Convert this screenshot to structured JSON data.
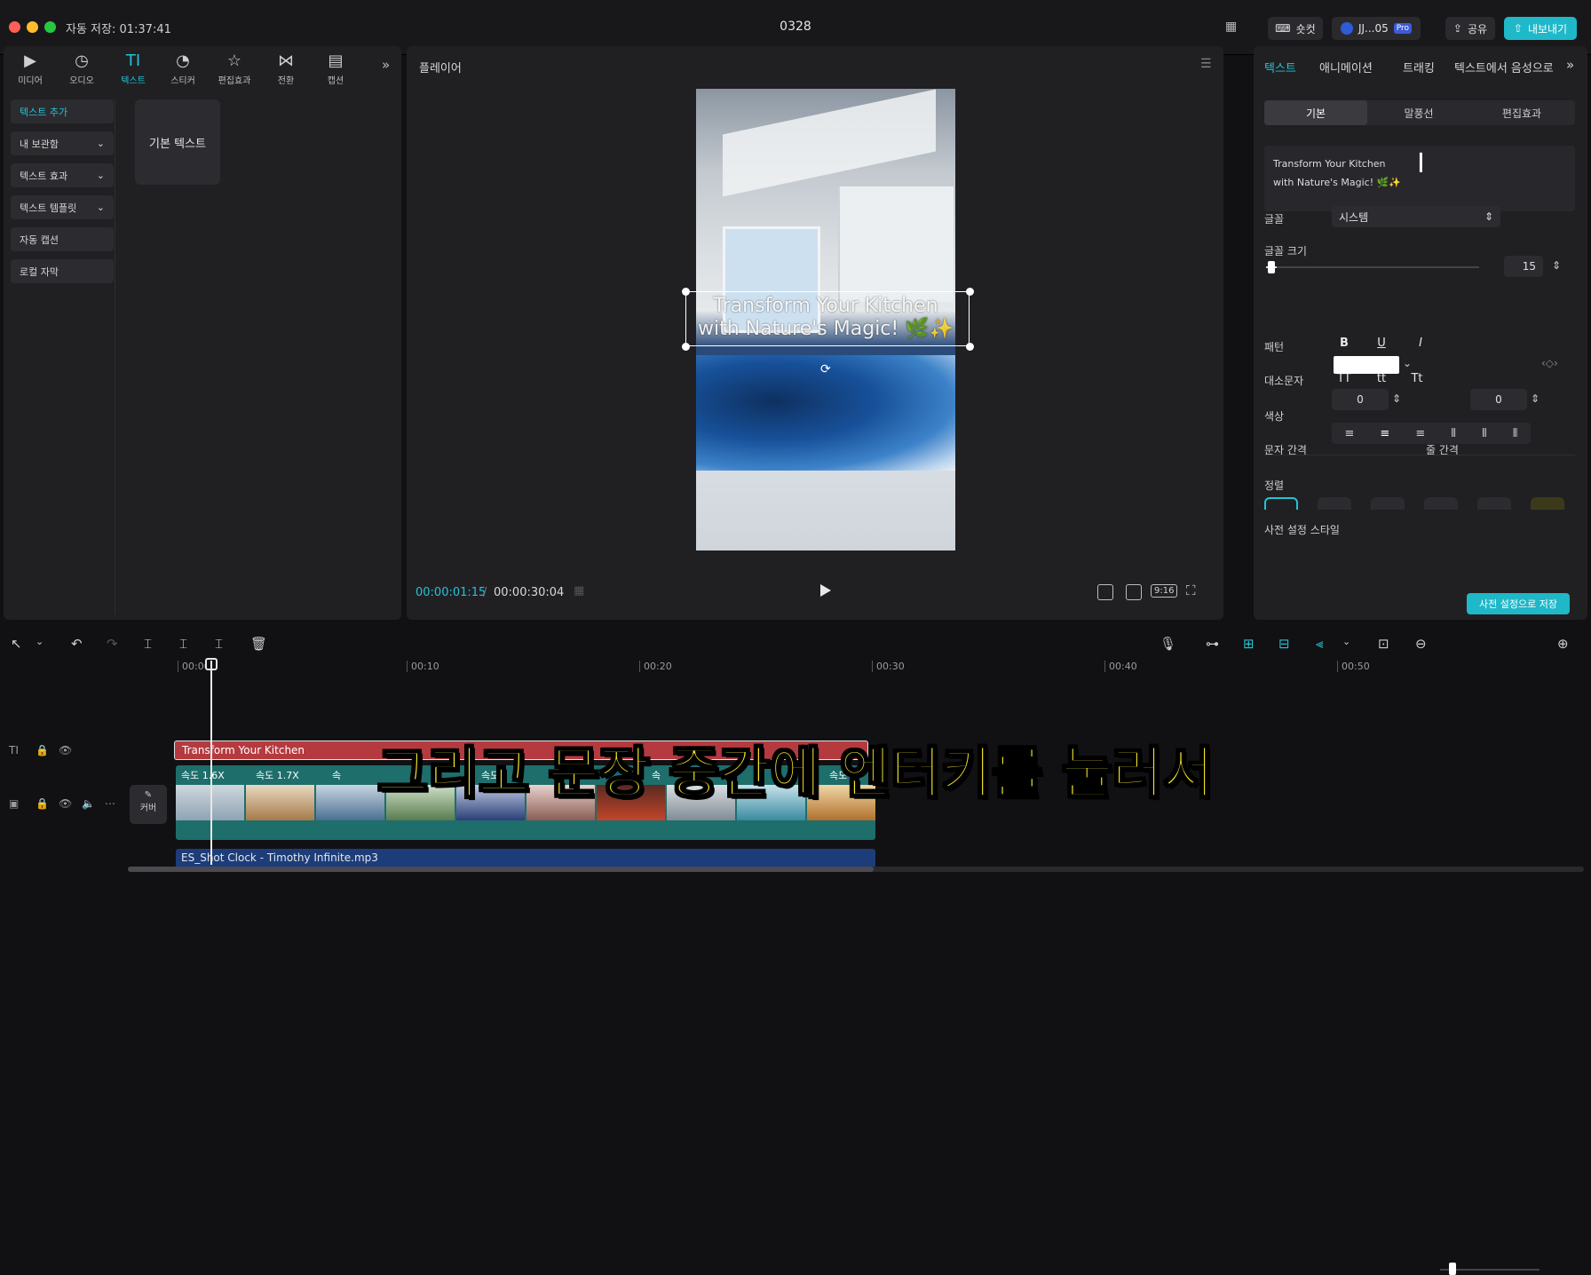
{
  "window": {
    "autosave": "자동 저장: 01:37:41",
    "project_name": "0328",
    "shortcut_label": "숏컷",
    "user": "JJ...05",
    "pro_badge": "Pro",
    "share_label": "공유",
    "export_label": "내보내기"
  },
  "toolbar": {
    "items": [
      {
        "label": "미디어",
        "icon": "media-icon"
      },
      {
        "label": "오디오",
        "icon": "audio-icon"
      },
      {
        "label": "텍스트",
        "icon": "text-icon"
      },
      {
        "label": "스티커",
        "icon": "sticker-icon"
      },
      {
        "label": "편집효과",
        "icon": "effects-icon"
      },
      {
        "label": "전환",
        "icon": "transition-icon"
      },
      {
        "label": "캡션",
        "icon": "caption-icon"
      }
    ],
    "more": "»"
  },
  "left_nav": {
    "items": [
      "텍스트 추가",
      "내 보관함",
      "텍스트 효과",
      "텍스트 템플릿",
      "자동 캡션",
      "로컬 자막"
    ],
    "active": "텍스트 추가"
  },
  "text_library": {
    "basic_text": "기본 텍스트"
  },
  "player": {
    "title": "플레이어",
    "overlay_text_line1": "Transform Your Kitchen",
    "overlay_text_line2": "with Nature's Magic! 🌿✨",
    "current_time": "00:00:01:15",
    "total_time": "00:00:30:04",
    "aspect_ratio": "9:16"
  },
  "inspector": {
    "tabs": [
      "텍스트",
      "애니메이션",
      "트래킹",
      "텍스트에서 음성으로"
    ],
    "active_tab": "텍스트",
    "subtabs": [
      "기본",
      "말풍선",
      "편집효과"
    ],
    "active_subtab": "기본",
    "text_line1": "Transform Your Kitchen",
    "text_line2": "with Nature's Magic! 🌿✨",
    "font_label": "글꼴",
    "font_value": "시스템",
    "size_label": "글꼴 크기",
    "size_value": "15",
    "size_fraction": 0.05,
    "pattern_label": "패턴",
    "pattern_buttons": [
      "B",
      "U",
      "I"
    ],
    "case_label": "대소문자",
    "case_buttons": [
      "TT",
      "tt",
      "Tt"
    ],
    "color_label": "색상",
    "color_value": "#ffffff",
    "char_spacing_label": "문자 간격",
    "char_spacing_value": "0",
    "line_spacing_label": "줄 간격",
    "line_spacing_value": "0",
    "align_label": "정렬",
    "preset_label": "사전 설정 스타일",
    "save_preset": "사전 설정으로 저장"
  },
  "timeline": {
    "ticks": [
      "00:00",
      "00:10",
      "00:20",
      "00:30",
      "00:40",
      "00:50"
    ],
    "text_clip": "Transform Your Kitchen",
    "speeds": [
      "속도 1.6X",
      "속도 1.7X",
      "속",
      "속도",
      "속",
      "속도"
    ],
    "cover_label": "커버",
    "audio_clip": "ES_Shot Clock - Timothy Infinite.mp3"
  },
  "subtitle_caption": "그리고 문장 중간에 엔터키를 눌러서",
  "colors": {
    "accent": "#24c3d6",
    "text_clip": "#b53a3f",
    "video_track": "#1e6e6b",
    "audio_track": "#1d3d7a",
    "caption": "#f5e62a"
  }
}
